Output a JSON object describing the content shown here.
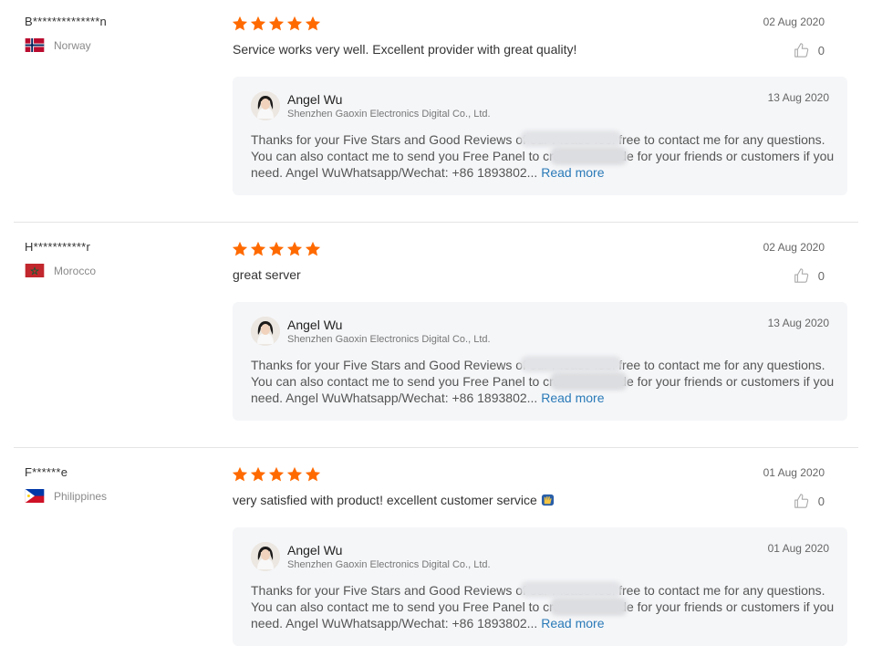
{
  "colors": {
    "star": "#ff6a00",
    "link": "#2a7ab8",
    "reply_bg": "#f5f6f8"
  },
  "reviews": [
    {
      "reviewer": "B**************n",
      "country": "Norway",
      "flag_icon": "norway-flag-icon",
      "rating": 5,
      "date": "02 Aug 2020",
      "text": "Service works very well. Excellent provider with great quality!",
      "likes": "0",
      "reply": {
        "name": "Angel Wu",
        "company": "Shenzhen Gaoxin Electronics Digital Co., Ltd.",
        "date": "13 Aug 2020",
        "text_a": "Thanks for your Five Stars and Good Reviews of our ",
        "text_b": " Please feel free to contact me for any questions. You can also contact me to send you Free ",
        "text_c": " Panel to create test code for your friends or customers if you need. Angel WuWhatsapp/Wechat: +86 1893802... ",
        "read_more": "Read more"
      }
    },
    {
      "reviewer": "H***********r",
      "country": "Morocco",
      "flag_icon": "morocco-flag-icon",
      "rating": 5,
      "date": "02 Aug 2020",
      "text": "great server",
      "likes": "0",
      "reply": {
        "name": "Angel Wu",
        "company": "Shenzhen Gaoxin Electronics Digital Co., Ltd.",
        "date": "13 Aug 2020",
        "text_a": "Thanks for your Five Stars and Good Reviews of our ",
        "text_b": " Please feel free to contact me for any questions. You can also contact me to send you Free ",
        "text_c": " Panel to create test code for your friends or customers if you need. Angel WuWhatsapp/Wechat: +86 1893802... ",
        "read_more": "Read more"
      }
    },
    {
      "reviewer": "F******e",
      "country": "Philippines",
      "flag_icon": "philippines-flag-icon",
      "rating": 5,
      "date": "01 Aug 2020",
      "text": "very satisfied with product! excellent customer service",
      "emoji": "raised-hands-emoji",
      "likes": "0",
      "reply": {
        "name": "Angel Wu",
        "company": "Shenzhen Gaoxin Electronics Digital Co., Ltd.",
        "date": "01 Aug 2020",
        "text_a": "Thanks for your Five Stars and Good Reviews of our ",
        "text_b": " Please feel free to contact me for any questions. You can also contact me to send you Free ",
        "text_c": " Panel to create test code for your friends or customers if you need. Angel WuWhatsapp/Wechat: +86 1893802... ",
        "read_more": "Read more"
      }
    }
  ]
}
